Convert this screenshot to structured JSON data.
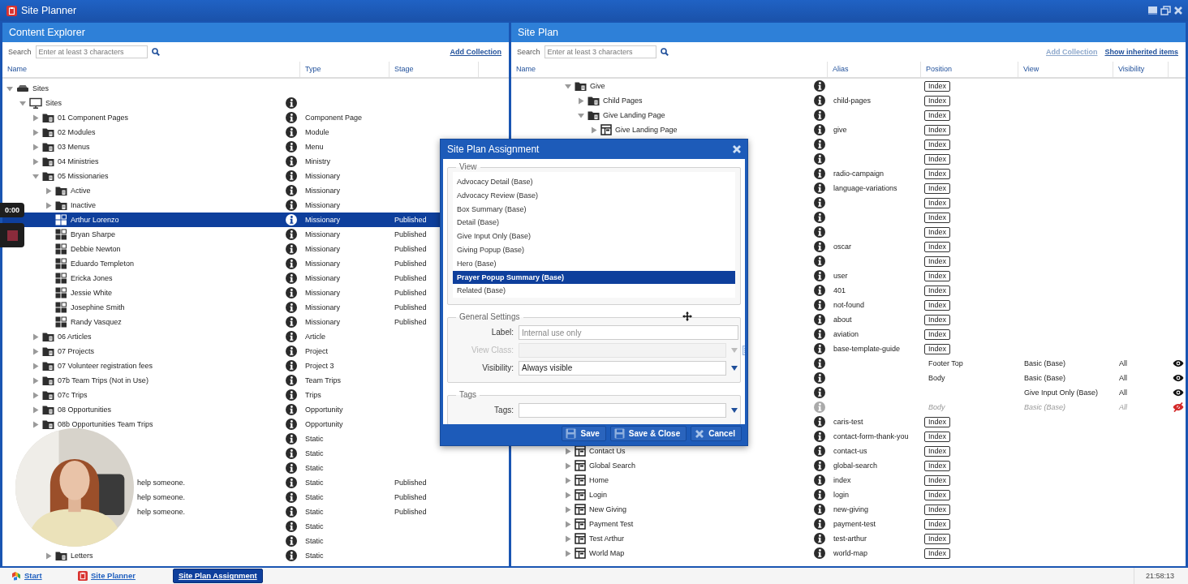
{
  "window": {
    "title": "Site Planner"
  },
  "left": {
    "title": "Content Explorer",
    "search": {
      "label": "Search",
      "placeholder": "Enter at least 3 characters"
    },
    "add_collection": {
      "label": "Add Collection",
      "disabled": false
    },
    "columns": [
      "Name",
      "Type",
      "Stage"
    ],
    "tree": [
      {
        "kind": "root",
        "name": "Sites",
        "expanded": true,
        "selected": false,
        "children": [
          {
            "kind": "site",
            "name": "Sites",
            "expanded": true,
            "selected": false,
            "children": [
              {
                "kind": "folder",
                "name": "01 Component Pages",
                "expanded": false,
                "type": "Component Page",
                "selected": false
              },
              {
                "kind": "folder",
                "name": "02 Modules",
                "expanded": false,
                "type": "Module",
                "selected": false
              },
              {
                "kind": "folder",
                "name": "03 Menus",
                "expanded": false,
                "type": "Menu",
                "selected": false
              },
              {
                "kind": "folder",
                "name": "04 Ministries",
                "expanded": false,
                "type": "Ministry",
                "selected": false
              },
              {
                "kind": "folder",
                "name": "05 Missionaries",
                "expanded": true,
                "type": "Missionary",
                "selected": false,
                "children": [
                  {
                    "kind": "folder",
                    "name": "Active",
                    "expanded": false,
                    "type": "Missionary",
                    "selected": false
                  },
                  {
                    "kind": "folder",
                    "name": "Inactive",
                    "expanded": false,
                    "type": "Missionary",
                    "selected": false
                  },
                  {
                    "kind": "entry",
                    "name": "Arthur Lorenzo",
                    "type": "Missionary",
                    "stage": "Published",
                    "selected": true
                  },
                  {
                    "kind": "entry",
                    "name": "Bryan Sharpe",
                    "type": "Missionary",
                    "stage": "Published",
                    "selected": false
                  },
                  {
                    "kind": "entry",
                    "name": "Debbie Newton",
                    "type": "Missionary",
                    "stage": "Published",
                    "selected": false
                  },
                  {
                    "kind": "entry",
                    "name": "Eduardo Templeton",
                    "type": "Missionary",
                    "stage": "Published",
                    "selected": false
                  },
                  {
                    "kind": "entry",
                    "name": "Ericka Jones",
                    "type": "Missionary",
                    "stage": "Published",
                    "selected": false
                  },
                  {
                    "kind": "entry",
                    "name": "Jessie White",
                    "type": "Missionary",
                    "stage": "Published",
                    "selected": false
                  },
                  {
                    "kind": "entry",
                    "name": "Josephine Smith",
                    "type": "Missionary",
                    "stage": "Published",
                    "selected": false
                  },
                  {
                    "kind": "entry",
                    "name": "Randy Vasquez",
                    "type": "Missionary",
                    "stage": "Published",
                    "selected": false
                  }
                ]
              },
              {
                "kind": "folder",
                "name": "06 Articles",
                "expanded": false,
                "type": "Article",
                "selected": false
              },
              {
                "kind": "folder",
                "name": "07 Projects",
                "expanded": false,
                "type": "Project",
                "selected": false
              },
              {
                "kind": "folder",
                "name": "07 Volunteer registration fees",
                "expanded": false,
                "type": "Project 3",
                "selected": false
              },
              {
                "kind": "folder",
                "name": "07b Team Trips (Not in Use)",
                "expanded": false,
                "type": "Team Trips",
                "selected": false
              },
              {
                "kind": "folder",
                "name": "07c Trips",
                "expanded": false,
                "type": "Trips",
                "selected": false
              },
              {
                "kind": "folder",
                "name": "08 Opportunities",
                "expanded": false,
                "type": "Opportunity",
                "selected": false
              },
              {
                "kind": "folder",
                "name": "08b Opportunities Team Trips",
                "expanded": false,
                "type": "Opportunity",
                "selected": false
              },
              {
                "kind": "obscured",
                "type": "Static",
                "selected": false,
                "children": [
                  {
                    "kind": "obscured",
                    "type": "Static",
                    "selected": false
                  },
                  {
                    "kind": "obscured",
                    "type": "Static",
                    "selected": false
                  },
                  {
                    "kind": "obscured",
                    "name": "help someone.",
                    "type": "Static",
                    "stage": "Published",
                    "selected": false
                  },
                  {
                    "kind": "obscured",
                    "name": "help someone.",
                    "type": "Static",
                    "stage": "Published",
                    "selected": false
                  },
                  {
                    "kind": "obscured",
                    "name": "help someone.",
                    "type": "Static",
                    "stage": "Published",
                    "selected": false
                  },
                  {
                    "kind": "obscured",
                    "type": "Static",
                    "selected": false
                  },
                  {
                    "kind": "obscured",
                    "type": "Static",
                    "selected": false
                  },
                  {
                    "kind": "folder",
                    "name": "Letters",
                    "expanded": false,
                    "type": "Static",
                    "selected": false
                  }
                ]
              }
            ]
          }
        ]
      }
    ]
  },
  "right": {
    "title": "Site Plan",
    "search": {
      "label": "Search",
      "placeholder": "Enter at least 3 characters"
    },
    "add_collection": {
      "label": "Add Collection",
      "disabled": true
    },
    "show_inherited": "Show inherited items",
    "columns": [
      "Name",
      "Alias",
      "Position",
      "View",
      "Visibility"
    ],
    "tree": [
      {
        "kind": "folder",
        "name": "Give",
        "expanded": true,
        "position": "Index",
        "selected": false,
        "children": [
          {
            "kind": "folder",
            "name": "Child Pages",
            "expanded": false,
            "alias": "child-pages",
            "position": "Index",
            "selected": false
          },
          {
            "kind": "folder",
            "name": "Give Landing Page",
            "expanded": true,
            "position": "Index",
            "selected": false,
            "children": [
              {
                "kind": "page",
                "name": "Give Landing Page",
                "expanded": false,
                "alias": "give",
                "position": "Index",
                "selected": false
              }
            ]
          }
        ]
      },
      {
        "kind": "covered",
        "position": "Index",
        "selected": false
      },
      {
        "kind": "covered",
        "position": "Index",
        "selected": false
      },
      {
        "kind": "covered",
        "alias": "radio-campaign",
        "position": "Index",
        "selected": false
      },
      {
        "kind": "covered",
        "alias": "language-variations",
        "position": "Index",
        "selected": false
      },
      {
        "kind": "covered",
        "position": "Index",
        "selected": false
      },
      {
        "kind": "covered",
        "position": "Index",
        "selected": false
      },
      {
        "kind": "covered",
        "position": "Index",
        "selected": false
      },
      {
        "kind": "covered",
        "alias": "oscar",
        "position": "Index",
        "selected": false
      },
      {
        "kind": "covered",
        "position": "Index",
        "selected": false
      },
      {
        "kind": "covered",
        "alias": "user",
        "position": "Index",
        "selected": false
      },
      {
        "kind": "covered",
        "alias": "401",
        "position": "Index",
        "selected": false
      },
      {
        "kind": "covered",
        "alias": "not-found",
        "position": "Index",
        "selected": false
      },
      {
        "kind": "covered",
        "alias": "about",
        "position": "Index",
        "selected": false
      },
      {
        "kind": "covered",
        "alias": "aviation",
        "position": "Index",
        "selected": false
      },
      {
        "kind": "covered",
        "alias": "base-template-guide",
        "position": "Index",
        "selected": false
      },
      {
        "kind": "zone",
        "position": "Footer Top",
        "view": "Basic (Base)",
        "visibility": "All",
        "visible": true,
        "selected": false
      },
      {
        "kind": "zone",
        "position": "Body",
        "view": "Basic (Base)",
        "visibility": "All",
        "visible": true,
        "selected": false
      },
      {
        "kind": "zone",
        "view": "Give Input Only (Base)",
        "visibility": "All",
        "visible": true,
        "selected": false
      },
      {
        "kind": "zone",
        "position": "Body",
        "view": "Basic (Base)",
        "visibility": "All",
        "visible": false,
        "selected": false
      },
      {
        "kind": "covered",
        "alias": "caris-test",
        "position": "Index",
        "selected": false
      },
      {
        "kind": "covered",
        "alias": "contact-form-thank-you",
        "position": "Index",
        "selected": false
      },
      {
        "kind": "page",
        "name": "Contact Us",
        "expanded": false,
        "alias": "contact-us",
        "position": "Index",
        "selected": false
      },
      {
        "kind": "page",
        "name": "Global Search",
        "expanded": false,
        "alias": "global-search",
        "position": "Index",
        "selected": false
      },
      {
        "kind": "page",
        "name": "Home",
        "expanded": false,
        "alias": "index",
        "position": "Index",
        "selected": false
      },
      {
        "kind": "page",
        "name": "Login",
        "expanded": false,
        "alias": "login",
        "position": "Index",
        "selected": false
      },
      {
        "kind": "page",
        "name": "New Giving",
        "expanded": false,
        "alias": "new-giving",
        "position": "Index",
        "selected": false
      },
      {
        "kind": "page",
        "name": "Payment Test",
        "expanded": false,
        "alias": "payment-test",
        "position": "Index",
        "selected": false
      },
      {
        "kind": "page",
        "name": "Test Arthur",
        "expanded": false,
        "alias": "test-arthur",
        "position": "Index",
        "selected": false
      },
      {
        "kind": "page",
        "name": "World Map",
        "expanded": false,
        "alias": "world-map",
        "position": "Index",
        "selected": false
      }
    ]
  },
  "dialog": {
    "title": "Site Plan Assignment",
    "view_legend": "View",
    "views": [
      {
        "label": "Advocacy Detail (Base)",
        "selected": false
      },
      {
        "label": "Advocacy Review (Base)",
        "selected": false
      },
      {
        "label": "Box Summary (Base)",
        "selected": false
      },
      {
        "label": "Detail (Base)",
        "selected": false
      },
      {
        "label": "Give Input Only (Base)",
        "selected": false
      },
      {
        "label": "Giving Popup (Base)",
        "selected": false
      },
      {
        "label": "Hero (Base)",
        "selected": false
      },
      {
        "label": "Prayer Popup Summary (Base)",
        "selected": true
      },
      {
        "label": "Related (Base)",
        "selected": false
      }
    ],
    "general_legend": "General Settings",
    "fields": [
      {
        "label": "Label:",
        "kind": "text",
        "placeholder": "Internal use only",
        "disabled": false
      },
      {
        "label": "View Class:",
        "kind": "lookup",
        "disabled": true
      },
      {
        "label": "Visibility:",
        "kind": "select",
        "value": "Always visible",
        "disabled": false
      }
    ],
    "tags_legend": "Tags",
    "tags_label": "Tags:",
    "buttons": [
      {
        "label": "Save",
        "kind": "save"
      },
      {
        "label": "Save & Close",
        "kind": "save-close"
      },
      {
        "label": "Cancel",
        "kind": "cancel"
      }
    ]
  },
  "taskbar": {
    "start": "Start",
    "tasks": [
      {
        "label": "Site Planner",
        "kind": "app",
        "selected": false
      },
      {
        "label": "Site Plan Assignment",
        "kind": "dialog",
        "selected": true
      }
    ],
    "clock": "21:58:13"
  },
  "video": {
    "timestamp": "0:00"
  }
}
